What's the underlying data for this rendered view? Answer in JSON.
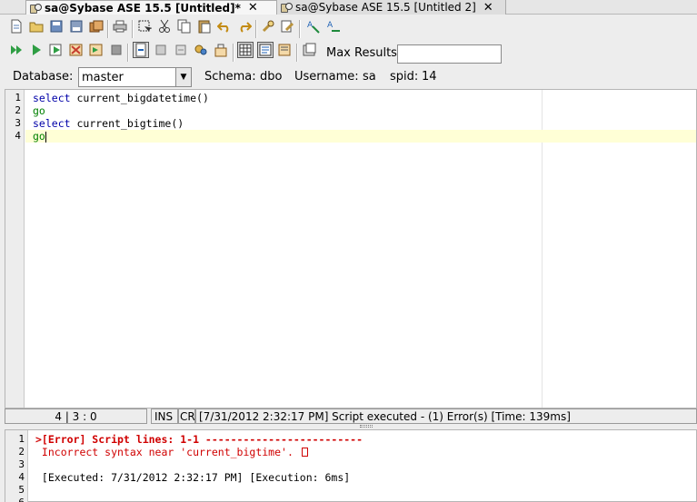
{
  "tabs": [
    {
      "label": "sa@Sybase ASE 15.5 [Untitled]*",
      "close": "✕",
      "active": true
    },
    {
      "label": "sa@Sybase ASE 15.5 [Untitled 2]",
      "close": "✕",
      "active": false
    }
  ],
  "toolbar": {
    "max_results_label": "Max Results:",
    "max_results_value": ""
  },
  "connection": {
    "database_label": "Database:",
    "database_value": "master",
    "schema_label": "Schema:",
    "schema_value": "dbo",
    "username_label": "Username:",
    "username_value": "sa",
    "spid_label": "spid:",
    "spid_value": "14"
  },
  "editor": {
    "line_numbers": [
      "1",
      "2",
      "3",
      "4"
    ],
    "lines": [
      {
        "kw": "select",
        "rest": " current_bigdatetime()"
      },
      {
        "go": "go"
      },
      {
        "kw": "select",
        "rest": " current_bigtime()"
      },
      {
        "go": "go"
      }
    ]
  },
  "status": {
    "position": "4 | 3 : 0",
    "ins": "INS",
    "cr": "CR",
    "message": "[7/31/2012 2:32:17 PM] Script executed - (1) Error(s) [Time: 139ms]"
  },
  "output": {
    "line_numbers": [
      "1",
      "2",
      "3",
      "4",
      "5",
      "6"
    ],
    "lines": [
      ">[Error] Script lines: 1-1 -------------------------",
      " Incorrect syntax near 'current_bigtime'. ",
      "",
      " [Executed: 7/31/2012 2:32:17 PM] [Execution: 6ms]",
      "",
      ""
    ]
  },
  "colors": {
    "keyword": "#0000a8",
    "go": "#008000",
    "error": "#d00000",
    "current_line": "#ffffd6"
  }
}
